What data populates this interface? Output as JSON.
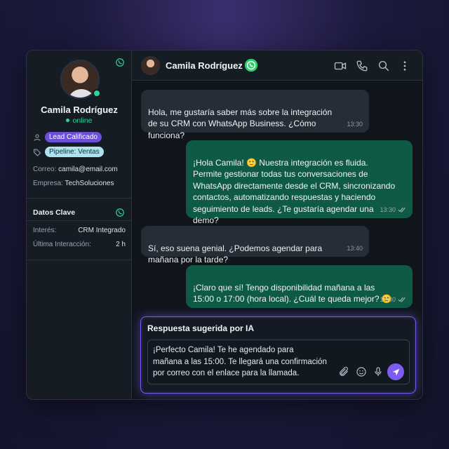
{
  "contact": {
    "name": "Camila Rodríguez",
    "status": "online",
    "tags": [
      "Lead Calificado",
      "Pipeline: Ventas"
    ],
    "email_label": "Correo:",
    "email": "camila@email.com",
    "company_label": "Empresa:",
    "company": "TechSoluciones"
  },
  "key_data": {
    "title": "Datos Clave",
    "rows": [
      {
        "key": "Interés:",
        "value": "CRM Integrado"
      },
      {
        "key": "Última Interacción:",
        "value": "2 h"
      }
    ]
  },
  "header": {
    "name": "Camila Rodríguez"
  },
  "messages": [
    {
      "dir": "in",
      "text": "Hola, me gustaría saber más sobre la integración\nde su CRM con WhatsApp Business. ¿Cómo\nfunciona?",
      "time": "13:30"
    },
    {
      "dir": "out",
      "text": "¡Hola Camila! 🙂 Nuestra integración es fluida.\nPermite gestionar todas tus conversaciones de\nWhatsApp directamente desde el CRM, sincronizando\ncontactos, automatizando respuestas y haciendo\nseguimiento de leads. ¿Te gustaría agendar una\ndemo?",
      "time": "13:30"
    },
    {
      "dir": "in",
      "text": "Sí, eso suena genial. ¿Podemos agendar para\nmañana por la tarde?",
      "time": "13:40"
    },
    {
      "dir": "out",
      "text": "¡Claro que sí! Tengo disponibilidad mañana a las\n15:00 o 17:00 (hora local). ¿Cuál te queda mejor? 🙂",
      "time": "13:30"
    }
  ],
  "ai_suggestion": {
    "title": "Respuesta sugerida por IA",
    "text": "¡Perfecto Camila! Te he agendado para\nmañana a las 15:00. Te llegará una confirmación\npor correo con el enlace para la llamada."
  },
  "colors": {
    "accent": "#7c5cf2",
    "whatsapp": "#25d366",
    "online": "#2fd39a",
    "outgoing_bubble": "#0f5a45"
  },
  "icons": [
    "whatsapp-icon",
    "video-icon",
    "phone-icon",
    "search-icon",
    "more-icon",
    "user-icon",
    "tag-icon",
    "attach-icon",
    "emoji-icon",
    "mic-icon",
    "send-icon"
  ]
}
